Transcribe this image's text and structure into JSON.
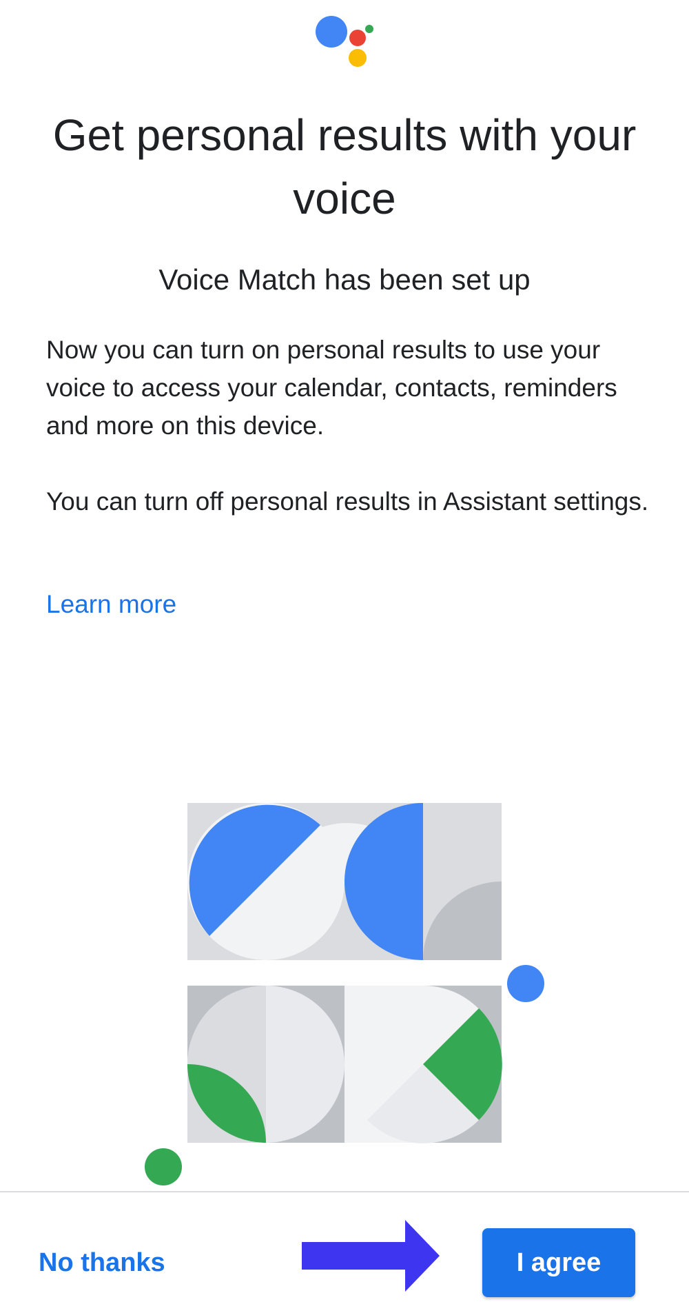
{
  "colors": {
    "accent": "#1a73e8",
    "google_blue": "#4285f4",
    "google_red": "#ea4335",
    "google_yellow": "#fbbc04",
    "google_green": "#34a853",
    "arrow": "#3d35f0"
  },
  "header": {
    "logo_icon": "google-assistant-logo-icon"
  },
  "main": {
    "title": "Get personal results with your voice",
    "subtitle": "Voice Match has been set up",
    "paragraph_1": "Now you can turn on personal results to use your voice to access your calendar, contacts, reminders and more on this device.",
    "paragraph_2": "You can turn off personal results in Assistant settings.",
    "learn_more": "Learn more"
  },
  "illustration": {
    "icon": "voice-match-illustration"
  },
  "footer": {
    "no_thanks": "No thanks",
    "agree": "I agree",
    "annotation_icon": "right-arrow-icon"
  }
}
